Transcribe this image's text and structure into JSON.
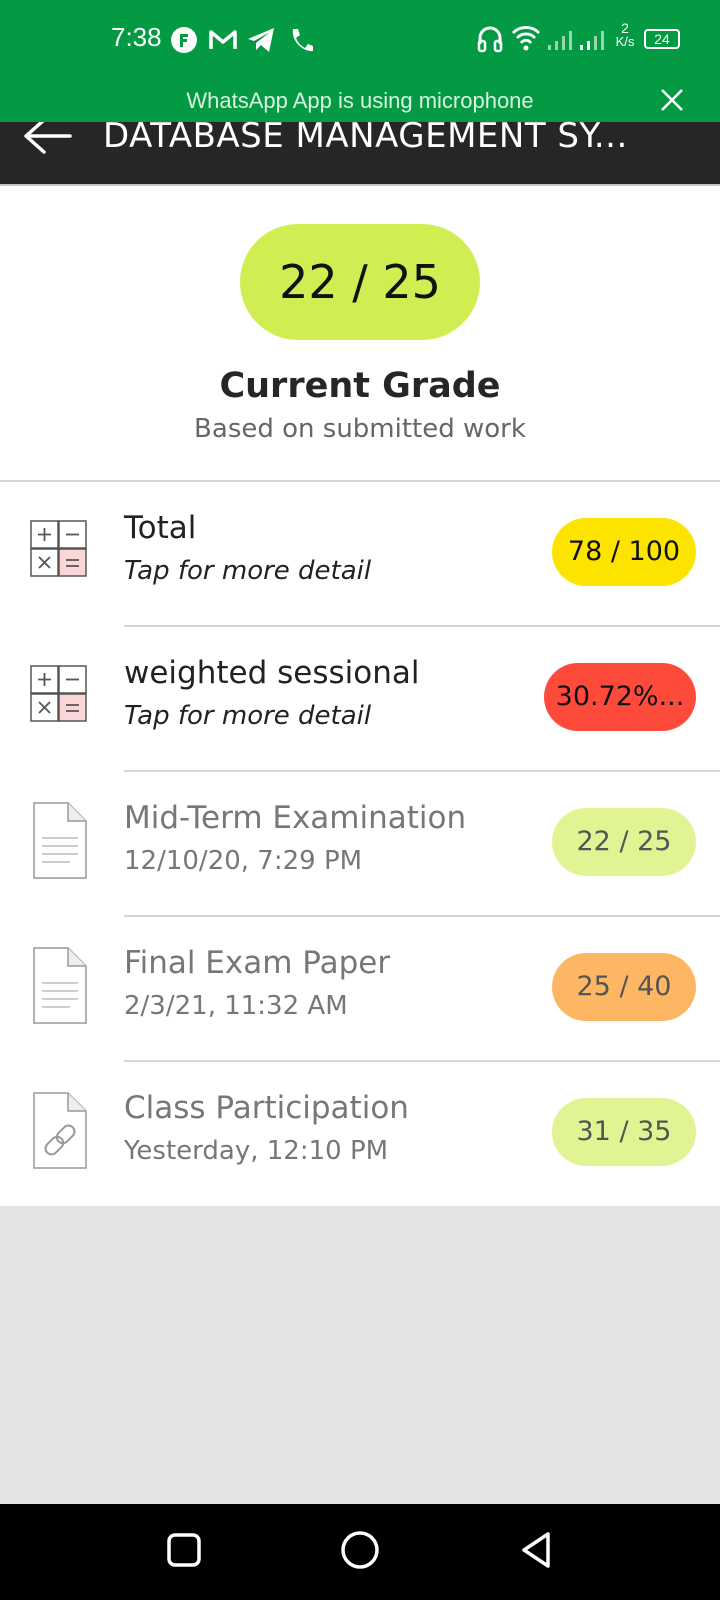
{
  "status_bar": {
    "time": "7:38",
    "speed_value": "2",
    "speed_unit": "K/s",
    "battery": "24",
    "icons": [
      "app-notification-icon",
      "gmail-icon",
      "telegram-icon",
      "phone-icon",
      "headset-icon",
      "wifi-icon",
      "signal-1-icon",
      "signal-2-icon",
      "battery-icon"
    ]
  },
  "mic_banner": {
    "text": "WhatsApp App is using microphone"
  },
  "app_bar": {
    "title": "DATABASE MANAGEMENT SY..."
  },
  "current_grade": {
    "value": "22 / 25",
    "label": "Current Grade",
    "sublabel": "Based on submitted work"
  },
  "grade_items": [
    {
      "title": "Total",
      "subtitle": "Tap for more detail",
      "score": "78 / 100",
      "badge_color": "#fde400",
      "icon": "calculator-icon"
    },
    {
      "title": "weighted sessional",
      "subtitle": "Tap for more detail",
      "score": "30.72%...",
      "badge_color": "#fd4a3a",
      "icon": "calculator-icon"
    },
    {
      "title": "Mid-Term Examination",
      "subtitle": "12/10/20, 7:29 PM",
      "score": "22 / 25",
      "badge_color": "#e1f494",
      "icon": "document-icon"
    },
    {
      "title": "Final Exam Paper",
      "subtitle": "2/3/21, 11:32 AM",
      "score": "25 / 40",
      "badge_color": "#fdb664",
      "icon": "document-icon"
    },
    {
      "title": "Class Participation",
      "subtitle": "Yesterday, 12:10 PM",
      "score": "31 / 35",
      "badge_color": "#e1f494",
      "icon": "link-document-icon"
    }
  ],
  "nav_bar": {
    "buttons": [
      "recents-square-icon",
      "home-circle-icon",
      "back-triangle-icon"
    ]
  },
  "colors": {
    "status_green": "#049a43",
    "app_bar": "#262626",
    "grade_pill": "#d0ee52"
  }
}
